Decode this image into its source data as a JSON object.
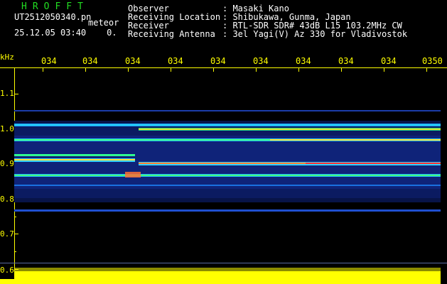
{
  "header": {
    "brand": "HROFFT",
    "filename": "UT2512050340.pn",
    "mode": "meteor",
    "datetime": "25.12.05 03:40",
    "extra": "0.",
    "meta": [
      {
        "label": "Observer",
        "value": ": Masaki Kano"
      },
      {
        "label": "Receiving Location",
        "value": ": Shibukawa, Gunma, Japan"
      },
      {
        "label": "Receiver",
        "value": ": RTL-SDR SDR# 43dB L15 103.2MHz CW"
      },
      {
        "label": "Receiving Antenna",
        "value": ": 3el Yagi(V) Az 330 for Vladivostok"
      }
    ]
  },
  "time_axis": {
    "ticks": [
      "034",
      "034",
      "034",
      "034",
      "034",
      "034",
      "034",
      "034",
      "034",
      "0350"
    ]
  },
  "freq_axis": {
    "unit": "kHz",
    "labels": [
      "1.1",
      "1.0",
      "0.9",
      "0.8",
      "0.7",
      "0.6"
    ]
  },
  "colors": {
    "header_text": "#ffffff",
    "brand": "#22dd22",
    "axis": "#ffff00",
    "background": "#000000"
  }
}
